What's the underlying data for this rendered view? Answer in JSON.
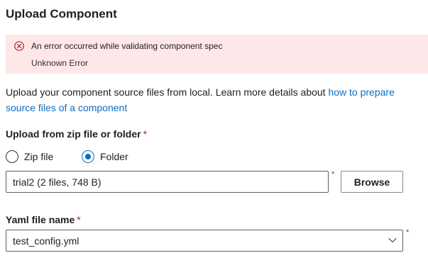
{
  "dialog": {
    "title": "Upload Component"
  },
  "error": {
    "icon": "error-circle-icon",
    "color": "#a4262c",
    "background": "#fde7e9",
    "title": "An error occurred while validating component spec",
    "detail": "Unknown Error"
  },
  "description": {
    "text": "Upload your component source files from local. Learn more details about ",
    "link_text": "how to prepare source files of a component",
    "link_color": "#0f6cbd"
  },
  "upload_section": {
    "label": "Upload from zip file or folder",
    "required_mark": "*",
    "options": [
      {
        "label": "Zip file",
        "selected": false
      },
      {
        "label": "Folder",
        "selected": true
      }
    ],
    "path_value": "trial2 (2 files, 748 B)",
    "browse_label": "Browse"
  },
  "yaml_section": {
    "label": "Yaml file name",
    "required_mark": "*",
    "selected_value": "test_config.yml",
    "chevron_icon": "chevron-down-icon"
  },
  "accent_color": "#0f6cbd"
}
